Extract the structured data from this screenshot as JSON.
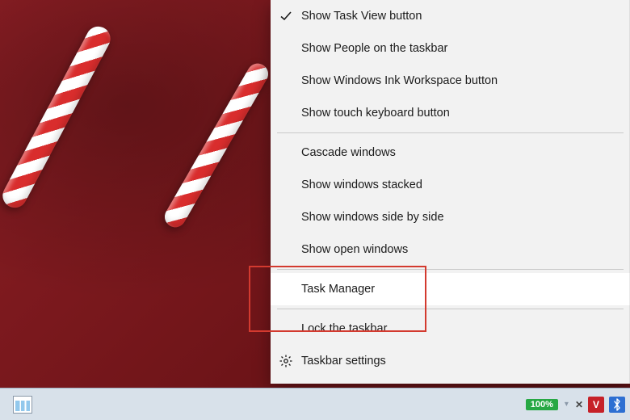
{
  "menu": {
    "items": [
      {
        "label": "Show Task View button",
        "checked": true
      },
      {
        "label": "Show People on the taskbar"
      },
      {
        "label": "Show Windows Ink Workspace button"
      },
      {
        "label": "Show touch keyboard button"
      }
    ],
    "window_items": [
      {
        "label": "Cascade windows"
      },
      {
        "label": "Show windows stacked"
      },
      {
        "label": "Show windows side by side"
      },
      {
        "label": "Show open windows"
      }
    ],
    "task_manager_label": "Task Manager",
    "lock_taskbar_label": "Lock the taskbar",
    "taskbar_settings_label": "Taskbar settings"
  },
  "taskbar": {
    "battery_text": "100%",
    "v_badge": "V",
    "bt_glyph": "฿"
  }
}
